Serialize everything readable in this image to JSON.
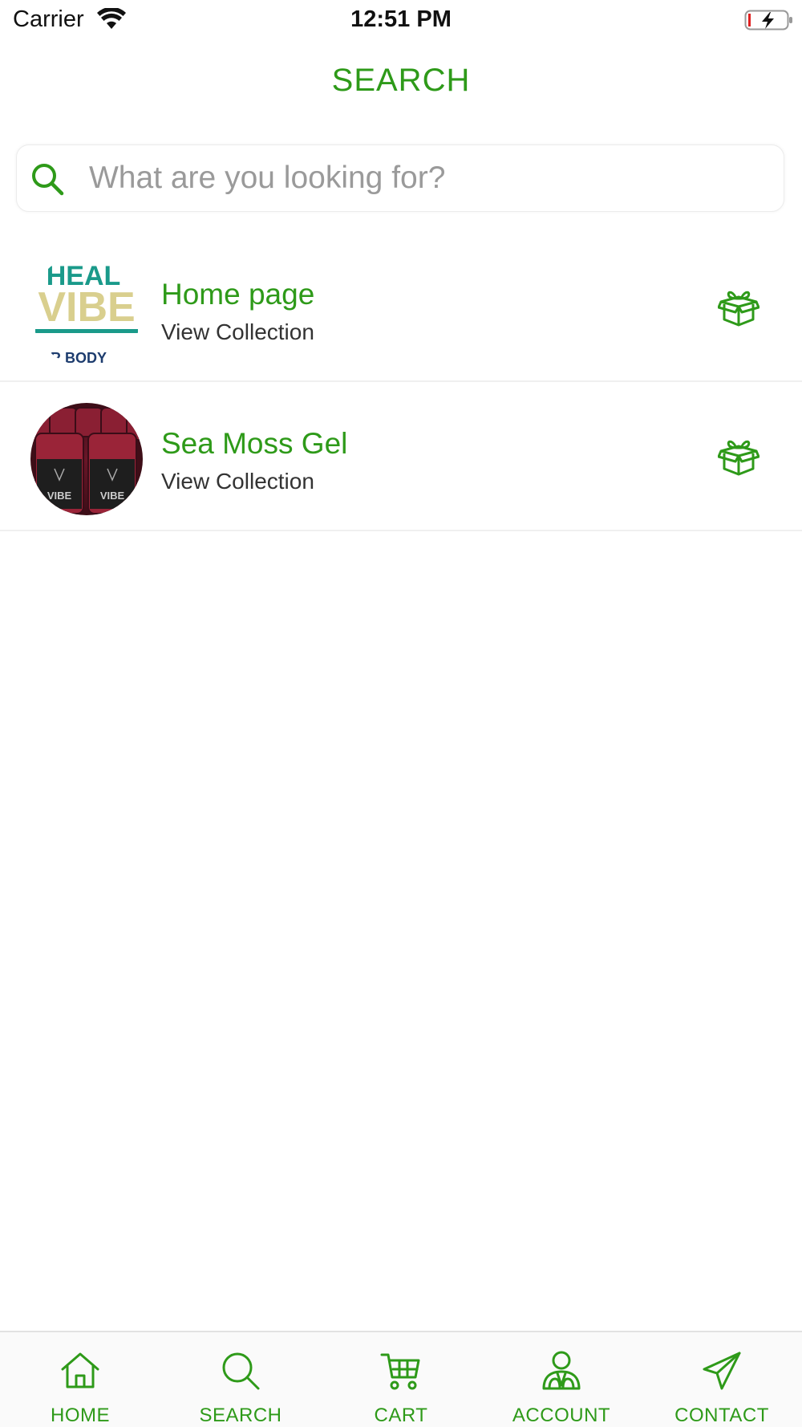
{
  "status_bar": {
    "carrier": "Carrier",
    "time": "12:51 PM"
  },
  "header": {
    "title": "SEARCH"
  },
  "search": {
    "placeholder": "What are you looking for?",
    "value": ""
  },
  "results": [
    {
      "name": "Home page",
      "subtitle": "View Collection",
      "thumb_lettering": [
        "HEAL",
        "VIBE",
        "R BODY"
      ],
      "icon": "gift-box-icon"
    },
    {
      "name": "Sea Moss Gel",
      "subtitle": "View Collection",
      "thumb_lettering": [
        "VIBE",
        "VIBE"
      ],
      "icon": "gift-box-icon"
    }
  ],
  "tabs": [
    {
      "label": "HOME",
      "icon": "home-icon"
    },
    {
      "label": "SEARCH",
      "icon": "search-icon"
    },
    {
      "label": "CART",
      "icon": "cart-icon"
    },
    {
      "label": "ACCOUNT",
      "icon": "account-icon"
    },
    {
      "label": "CONTACT",
      "icon": "send-icon"
    }
  ],
  "colors": {
    "accent": "#2e9a19",
    "text": "#333333",
    "placeholder": "#9a9a9a",
    "background": "#ffffff"
  }
}
